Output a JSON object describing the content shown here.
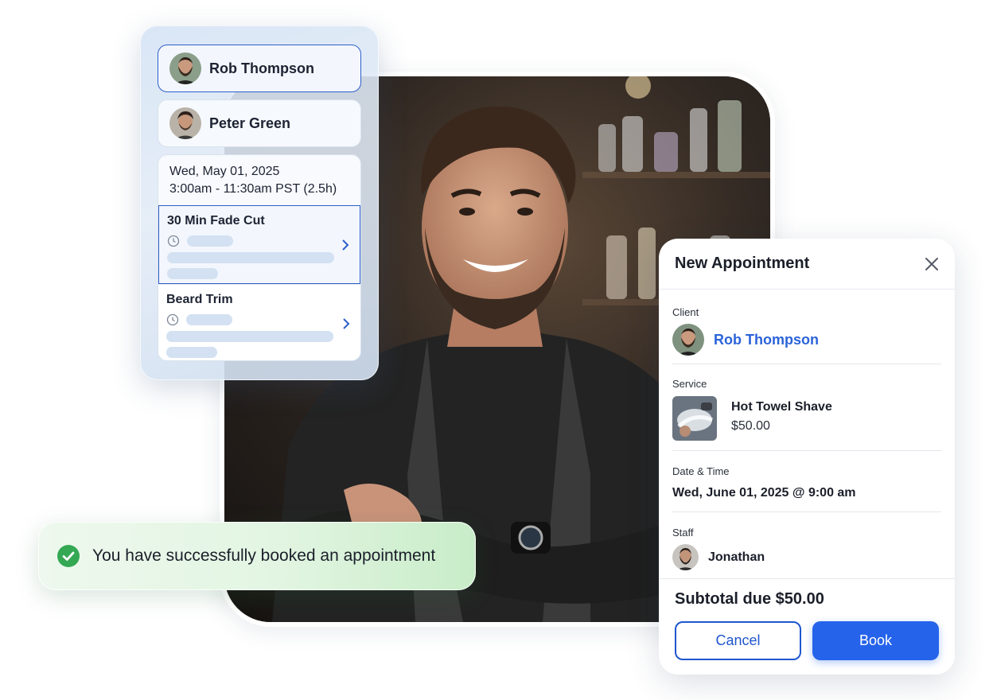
{
  "staff_panel": {
    "staff": [
      {
        "name": "Rob Thompson",
        "selected": true
      },
      {
        "name": "Peter Green",
        "selected": false
      }
    ],
    "schedule": {
      "date": "Wed, May 01, 2025",
      "time": "3:00am - 11:30am PST (2.5h)"
    },
    "services": [
      {
        "name": "30 Min Fade Cut",
        "selected": true
      },
      {
        "name": "Beard Trim",
        "selected": false
      }
    ]
  },
  "toast": {
    "message": "You have successfully booked an appointment"
  },
  "modal": {
    "title": "New Appointment",
    "client": {
      "label": "Client",
      "name": "Rob Thompson"
    },
    "service": {
      "label": "Service",
      "name": "Hot Towel Shave",
      "price": "$50.00"
    },
    "datetime": {
      "label": "Date & Time",
      "value": "Wed, June 01, 2025 @ 9:00 am"
    },
    "staff": {
      "label": "Staff",
      "name": "Jonathan"
    },
    "subtotal": "Subtotal due $50.00",
    "cancel_label": "Cancel",
    "book_label": "Book"
  },
  "colors": {
    "accent": "#2563eb",
    "link": "#2b63d9",
    "success": "#34a853"
  }
}
